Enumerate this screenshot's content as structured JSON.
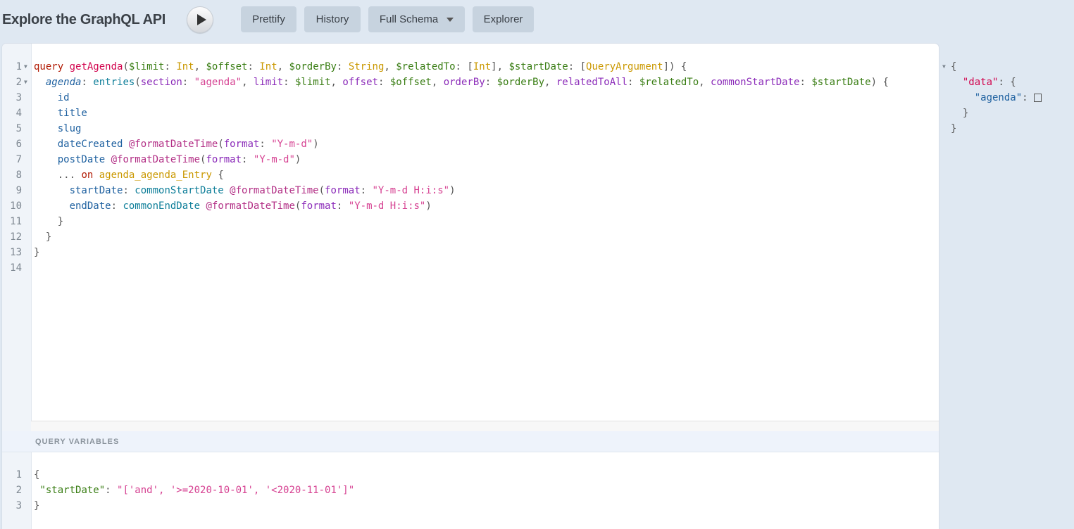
{
  "header": {
    "title": "Explore the GraphQL API",
    "run_label": "Execute Query",
    "buttons": {
      "prettify": "Prettify",
      "history": "History",
      "schema": "Full Schema",
      "explorer": "Explorer"
    }
  },
  "query_editor": {
    "lines": [
      {
        "n": "1",
        "fold": true,
        "tokens": [
          [
            "kw",
            "query"
          ],
          [
            "punct",
            " "
          ],
          [
            "def",
            "getAgenda"
          ],
          [
            "punct",
            "("
          ],
          [
            "var",
            "$limit"
          ],
          [
            "punct",
            ": "
          ],
          [
            "type",
            "Int"
          ],
          [
            "punct",
            ", "
          ],
          [
            "var",
            "$offset"
          ],
          [
            "punct",
            ": "
          ],
          [
            "type",
            "Int"
          ],
          [
            "punct",
            ", "
          ],
          [
            "var",
            "$orderBy"
          ],
          [
            "punct",
            ": "
          ],
          [
            "type",
            "String"
          ],
          [
            "punct",
            ", "
          ],
          [
            "var",
            "$relatedTo"
          ],
          [
            "punct",
            ": ["
          ],
          [
            "type",
            "Int"
          ],
          [
            "punct",
            "], "
          ],
          [
            "var",
            "$startDate"
          ],
          [
            "punct",
            ": ["
          ],
          [
            "type",
            "QueryArgument"
          ],
          [
            "punct",
            "]) {"
          ]
        ]
      },
      {
        "n": "2",
        "fold": true,
        "tokens": [
          [
            "punct",
            "  "
          ],
          [
            "prop italic",
            "agenda"
          ],
          [
            "punct",
            ": "
          ],
          [
            "query-field",
            "entries"
          ],
          [
            "punct",
            "("
          ],
          [
            "attr",
            "section"
          ],
          [
            "punct",
            ": "
          ],
          [
            "str",
            "\"agenda\""
          ],
          [
            "punct",
            ", "
          ],
          [
            "attr",
            "limit"
          ],
          [
            "punct",
            ": "
          ],
          [
            "var",
            "$limit"
          ],
          [
            "punct",
            ", "
          ],
          [
            "attr",
            "offset"
          ],
          [
            "punct",
            ": "
          ],
          [
            "var",
            "$offset"
          ],
          [
            "punct",
            ", "
          ],
          [
            "attr",
            "orderBy"
          ],
          [
            "punct",
            ": "
          ],
          [
            "var",
            "$orderBy"
          ],
          [
            "punct",
            ", "
          ],
          [
            "attr",
            "relatedToAll"
          ],
          [
            "punct",
            ": "
          ],
          [
            "var",
            "$relatedTo"
          ],
          [
            "punct",
            ", "
          ],
          [
            "attr",
            "commonStartDate"
          ],
          [
            "punct",
            ": "
          ],
          [
            "var",
            "$startDate"
          ],
          [
            "punct",
            ") {"
          ]
        ]
      },
      {
        "n": "3",
        "fold": false,
        "tokens": [
          [
            "punct",
            "    "
          ],
          [
            "field",
            "id"
          ]
        ]
      },
      {
        "n": "4",
        "fold": false,
        "tokens": [
          [
            "punct",
            "    "
          ],
          [
            "field",
            "title"
          ]
        ]
      },
      {
        "n": "5",
        "fold": false,
        "tokens": [
          [
            "punct",
            "    "
          ],
          [
            "field",
            "slug"
          ]
        ]
      },
      {
        "n": "6",
        "fold": false,
        "tokens": [
          [
            "punct",
            "    "
          ],
          [
            "field",
            "dateCreated"
          ],
          [
            "punct",
            " "
          ],
          [
            "dir",
            "@formatDateTime"
          ],
          [
            "punct",
            "("
          ],
          [
            "attr",
            "format"
          ],
          [
            "punct",
            ": "
          ],
          [
            "str",
            "\"Y-m-d\""
          ],
          [
            "punct",
            ")"
          ]
        ]
      },
      {
        "n": "7",
        "fold": false,
        "tokens": [
          [
            "punct",
            "    "
          ],
          [
            "field",
            "postDate"
          ],
          [
            "punct",
            " "
          ],
          [
            "dir",
            "@formatDateTime"
          ],
          [
            "punct",
            "("
          ],
          [
            "attr",
            "format"
          ],
          [
            "punct",
            ": "
          ],
          [
            "str",
            "\"Y-m-d\""
          ],
          [
            "punct",
            ")"
          ]
        ]
      },
      {
        "n": "8",
        "fold": false,
        "tokens": [
          [
            "punct",
            "    ... "
          ],
          [
            "kw",
            "on"
          ],
          [
            "punct",
            " "
          ],
          [
            "type",
            "agenda_agenda_Entry"
          ],
          [
            "punct",
            " {"
          ]
        ]
      },
      {
        "n": "9",
        "fold": false,
        "tokens": [
          [
            "punct",
            "      "
          ],
          [
            "field",
            "startDate"
          ],
          [
            "punct",
            ": "
          ],
          [
            "query-field",
            "commonStartDate"
          ],
          [
            "punct",
            " "
          ],
          [
            "dir",
            "@formatDateTime"
          ],
          [
            "punct",
            "("
          ],
          [
            "attr",
            "format"
          ],
          [
            "punct",
            ": "
          ],
          [
            "str",
            "\"Y-m-d H:i:s\""
          ],
          [
            "punct",
            ")"
          ]
        ]
      },
      {
        "n": "10",
        "fold": false,
        "tokens": [
          [
            "punct",
            "      "
          ],
          [
            "field",
            "endDate"
          ],
          [
            "punct",
            ": "
          ],
          [
            "query-field",
            "commonEndDate"
          ],
          [
            "punct",
            " "
          ],
          [
            "dir",
            "@formatDateTime"
          ],
          [
            "punct",
            "("
          ],
          [
            "attr",
            "format"
          ],
          [
            "punct",
            ": "
          ],
          [
            "str",
            "\"Y-m-d H:i:s\""
          ],
          [
            "punct",
            ")"
          ]
        ]
      },
      {
        "n": "11",
        "fold": false,
        "tokens": [
          [
            "punct",
            "    }"
          ]
        ]
      },
      {
        "n": "12",
        "fold": false,
        "tokens": [
          [
            "punct",
            "  }"
          ]
        ]
      },
      {
        "n": "13",
        "fold": false,
        "tokens": [
          [
            "punct",
            "}"
          ]
        ]
      },
      {
        "n": "14",
        "fold": false,
        "tokens": []
      }
    ]
  },
  "variables_panel": {
    "header": "QUERY VARIABLES",
    "lines": [
      {
        "n": "1",
        "tokens": [
          [
            "punct",
            "{"
          ]
        ]
      },
      {
        "n": "2",
        "tokens": [
          [
            "punct",
            " "
          ],
          [
            "var",
            "\"startDate\""
          ],
          [
            "punct",
            ": "
          ],
          [
            "str",
            "\"['and', '>=2020-10-01', '<2020-11-01']\""
          ]
        ]
      },
      {
        "n": "3",
        "tokens": [
          [
            "punct",
            "}"
          ]
        ]
      }
    ]
  },
  "result_panel": {
    "lines": [
      {
        "fold": true,
        "tokens": [
          [
            "punct",
            "{"
          ]
        ]
      },
      {
        "fold": false,
        "tokens": [
          [
            "punct",
            "  "
          ],
          [
            "rkey-red",
            "\"data\""
          ],
          [
            "punct",
            ": {"
          ]
        ]
      },
      {
        "fold": false,
        "tokens": [
          [
            "punct",
            "    "
          ],
          [
            "rkey-blue",
            "\"agenda\""
          ],
          [
            "punct",
            ": "
          ],
          [
            "empty-array",
            ""
          ]
        ]
      },
      {
        "fold": false,
        "tokens": [
          [
            "punct",
            "  }"
          ]
        ]
      },
      {
        "fold": false,
        "tokens": [
          [
            "punct",
            "}"
          ]
        ]
      }
    ]
  },
  "icons": {
    "run": "play-icon",
    "schema_dropdown": "caret-down-icon",
    "fold": "fold-arrow-icon"
  }
}
